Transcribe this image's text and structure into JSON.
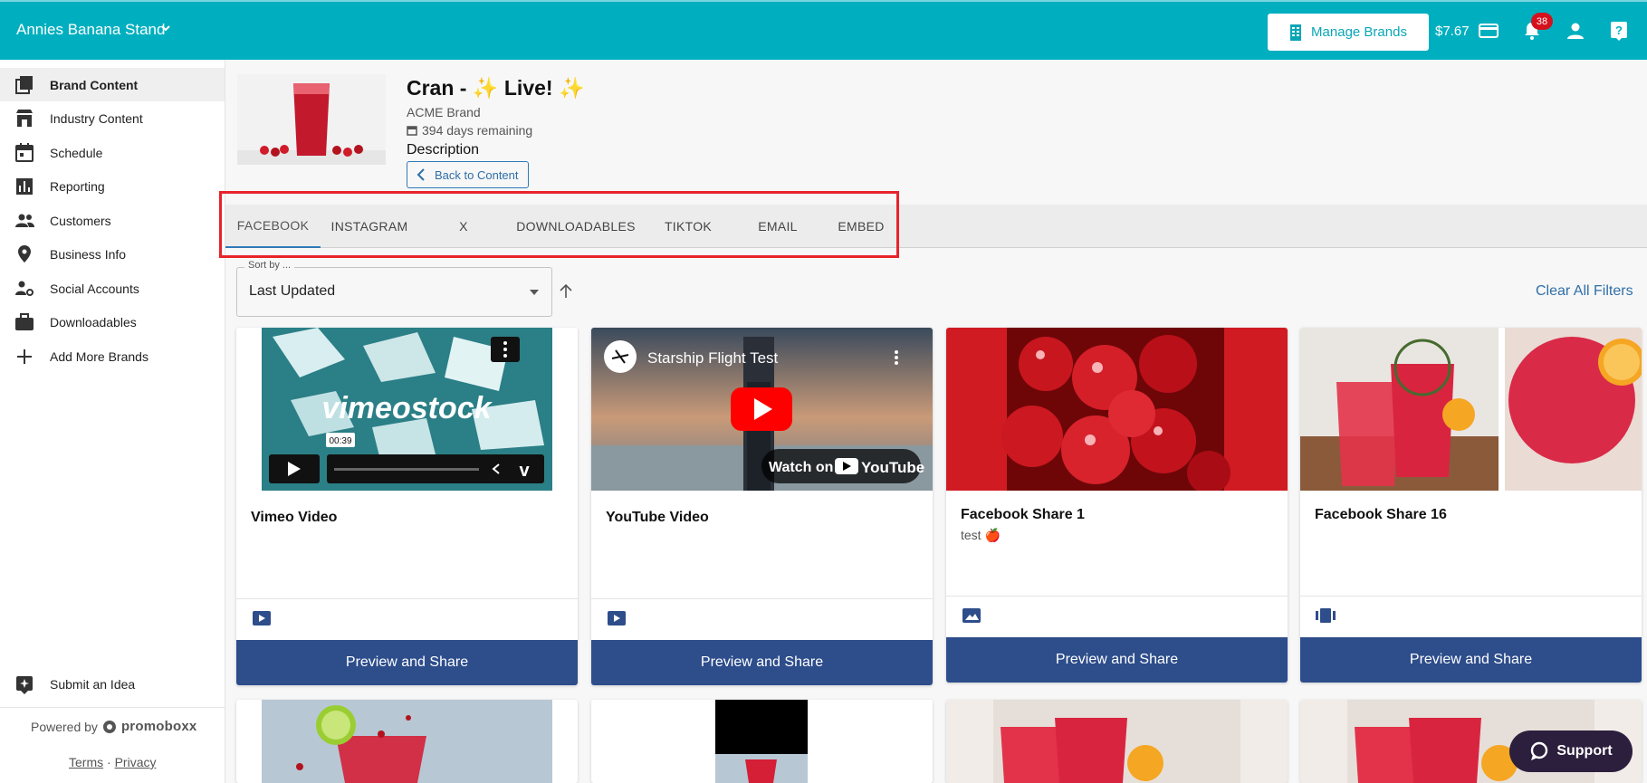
{
  "topbar": {
    "org_name": "Annies Banana Stand",
    "manage_brands_label": "Manage Brands",
    "balance": "$7.67",
    "notification_count": "38",
    "accent_color": "#00afbf"
  },
  "sidebar": {
    "items": [
      {
        "label": "Brand Content",
        "icon": "library-icon"
      },
      {
        "label": "Industry Content",
        "icon": "store-icon"
      },
      {
        "label": "Schedule",
        "icon": "calendar-icon"
      },
      {
        "label": "Reporting",
        "icon": "bar-chart-icon"
      },
      {
        "label": "Customers",
        "icon": "people-icon"
      },
      {
        "label": "Business Info",
        "icon": "location-pin-icon"
      },
      {
        "label": "Social Accounts",
        "icon": "account-settings-icon"
      },
      {
        "label": "Downloadables",
        "icon": "briefcase-icon"
      },
      {
        "label": "Add More Brands",
        "icon": "plus-icon"
      }
    ],
    "submit_idea_label": "Submit an Idea",
    "powered_by_label": "Powered by",
    "powered_brand": "promoboxx",
    "terms_label": "Terms",
    "separator": "·",
    "privacy_label": "Privacy"
  },
  "content": {
    "title_prefix": "Cran - ",
    "title_word": "Live!",
    "sparkle": "✨",
    "brand": "ACME Brand",
    "days_remaining": "394 days remaining",
    "description_label": "Description",
    "back_label": "Back to Content"
  },
  "tabs": [
    {
      "label": "FACEBOOK",
      "active": true
    },
    {
      "label": "INSTAGRAM",
      "active": false
    },
    {
      "label": "X",
      "active": false
    },
    {
      "label": "DOWNLOADABLES",
      "active": false
    },
    {
      "label": "TIKTOK",
      "active": false
    },
    {
      "label": "EMAIL",
      "active": false
    },
    {
      "label": "EMBED",
      "active": false
    }
  ],
  "sort": {
    "label": "Sort by ...",
    "value": "Last Updated"
  },
  "clear_filters_label": "Clear All Filters",
  "cards": [
    {
      "title": "Vimeo Video",
      "subtitle": "",
      "type_icon": "video-icon",
      "share_label": "Preview and Share",
      "media_text": "vimeostock",
      "duration": "00:39"
    },
    {
      "title": "YouTube Video",
      "subtitle": "",
      "type_icon": "video-icon",
      "share_label": "Preview and Share",
      "media_title": "Starship Flight Test",
      "watch_on": "Watch on",
      "youtube": "YouTube"
    },
    {
      "title": "Facebook Share 1",
      "subtitle": "test 🍎",
      "type_icon": "image-icon",
      "share_label": "Preview and Share"
    },
    {
      "title": "Facebook Share 16",
      "subtitle": "",
      "type_icon": "carousel-icon",
      "share_label": "Preview and Share"
    }
  ],
  "support_label": "Support"
}
